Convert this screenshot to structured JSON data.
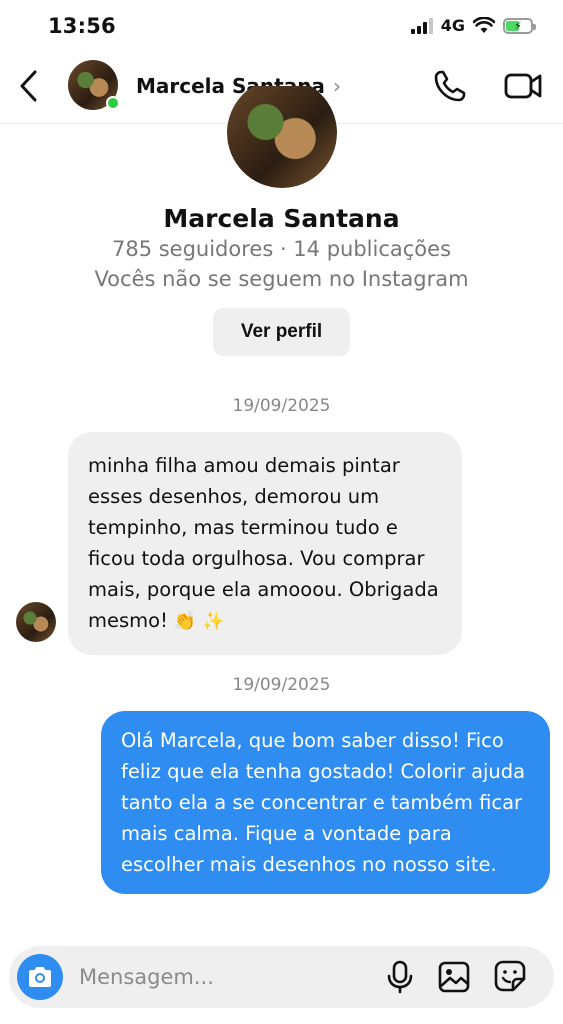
{
  "status_bar": {
    "time": "13:56",
    "network": "4G"
  },
  "header": {
    "name": "Marcela Santana"
  },
  "profile": {
    "name": "Marcela Santana",
    "stats": "785 seguidores · 14 publicações",
    "follow_status": "Vocês não se seguem no Instagram",
    "view_profile_label": "Ver perfil"
  },
  "messages": [
    {
      "date": "19/09/2025",
      "direction": "incoming",
      "text": "minha filha amou demais pintar esses desenhos, demorou um tempinho, mas terminou tudo e ficou toda orgulhosa. Vou comprar mais, porque ela amooou. Obrigada mesmo!",
      "emojis": "👏 ✨"
    },
    {
      "date": "19/09/2025",
      "direction": "outgoing",
      "text": "Olá Marcela, que bom saber disso! Fico feliz que ela tenha gostado! Colorir ajuda tanto ela a se concentrar e também ficar mais calma. Fique a vontade para escolher mais desenhos no nosso site."
    }
  ],
  "composer": {
    "placeholder": "Mensagem..."
  },
  "colors": {
    "accent": "#2f8cf0",
    "incoming_bubble": "#efefef",
    "online": "#2ecc40"
  }
}
